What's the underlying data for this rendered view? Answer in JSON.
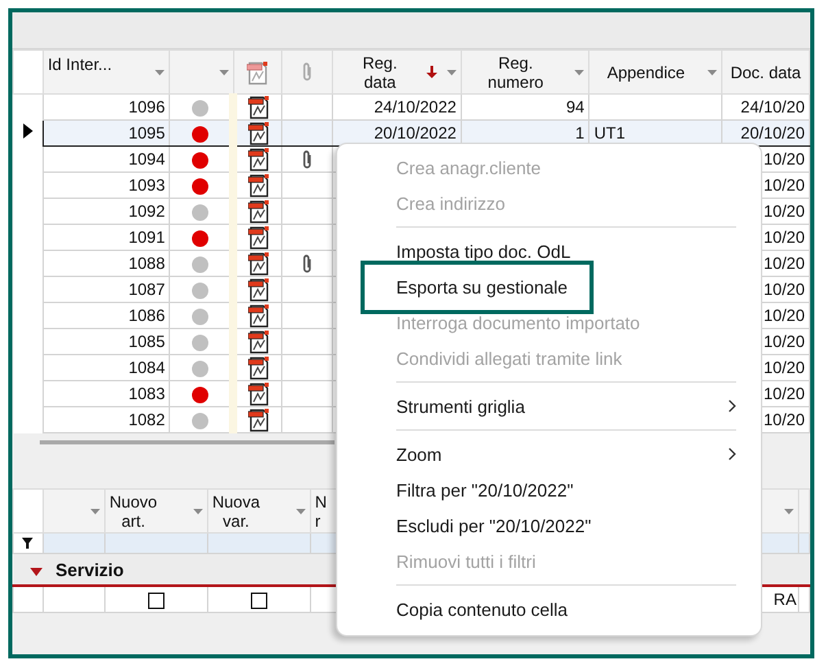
{
  "grid": {
    "columns": [
      {
        "kind": "number",
        "label": "Id Inter...",
        "filter": true
      },
      {
        "kind": "status",
        "filter": true
      },
      {
        "kind": "pdf"
      },
      {
        "kind": "attach"
      },
      {
        "kind": "date",
        "label": "Reg.\ndata",
        "sorted_desc": true,
        "filter": true
      },
      {
        "kind": "number",
        "label": "Reg.\nnumero",
        "filter": true
      },
      {
        "kind": "text",
        "label": "Appendice",
        "filter": true
      },
      {
        "kind": "date",
        "label": "Doc. data",
        "filter": false
      }
    ],
    "rows": [
      {
        "selected": false,
        "cells": [
          "1096",
          {
            "color": "#c0c0c0"
          },
          {
            "pdf": true
          },
          {
            "attachment": false
          },
          "24/10/2022",
          "94",
          "",
          "24/10/20"
        ]
      },
      {
        "selected": true,
        "cells": [
          "1095",
          {
            "color": "#e00000"
          },
          {
            "pdf": true
          },
          {
            "attachment": false
          },
          "20/10/2022",
          "1",
          "UT1",
          "20/10/20"
        ]
      },
      {
        "selected": false,
        "cells": [
          "1094",
          {
            "color": "#e00000"
          },
          {
            "pdf": true
          },
          {
            "attachment": true
          },
          "",
          "",
          "",
          "10/20"
        ]
      },
      {
        "selected": false,
        "cells": [
          "1093",
          {
            "color": "#e00000"
          },
          {
            "pdf": true
          },
          {
            "attachment": false
          },
          "",
          "",
          "",
          "10/20"
        ]
      },
      {
        "selected": false,
        "cells": [
          "1092",
          {
            "color": "#c0c0c0"
          },
          {
            "pdf": true
          },
          {
            "attachment": false
          },
          "",
          "",
          "",
          "10/20"
        ]
      },
      {
        "selected": false,
        "cells": [
          "1091",
          {
            "color": "#e00000"
          },
          {
            "pdf": true
          },
          {
            "attachment": false
          },
          "",
          "",
          "",
          "10/20"
        ]
      },
      {
        "selected": false,
        "cells": [
          "1088",
          {
            "color": "#c0c0c0"
          },
          {
            "pdf": true
          },
          {
            "attachment": true
          },
          "",
          "",
          "",
          "10/20"
        ]
      },
      {
        "selected": false,
        "cells": [
          "1087",
          {
            "color": "#c0c0c0"
          },
          {
            "pdf": true
          },
          {
            "attachment": false
          },
          "",
          "",
          "",
          "10/20"
        ]
      },
      {
        "selected": false,
        "cells": [
          "1086",
          {
            "color": "#c0c0c0"
          },
          {
            "pdf": true
          },
          {
            "attachment": false
          },
          "",
          "",
          "",
          "10/20"
        ]
      },
      {
        "selected": false,
        "cells": [
          "1085",
          {
            "color": "#c0c0c0"
          },
          {
            "pdf": true
          },
          {
            "attachment": false
          },
          "",
          "",
          "",
          "10/20"
        ]
      },
      {
        "selected": false,
        "cells": [
          "1084",
          {
            "color": "#c0c0c0"
          },
          {
            "pdf": true
          },
          {
            "attachment": false
          },
          "",
          "",
          "",
          "10/20"
        ]
      },
      {
        "selected": false,
        "cells": [
          "1083",
          {
            "color": "#e00000"
          },
          {
            "pdf": true
          },
          {
            "attachment": false
          },
          "",
          "",
          "",
          "10/20"
        ]
      },
      {
        "selected": false,
        "cells": [
          "1082",
          {
            "color": "#c0c0c0"
          },
          {
            "pdf": true
          },
          {
            "attachment": false
          },
          "",
          "",
          "",
          "10/20"
        ]
      }
    ]
  },
  "detail_grid": {
    "columns": [
      {
        "kind": "blank",
        "filter": true
      },
      {
        "kind": "check",
        "label": "Nuovo\nart.",
        "filter": true
      },
      {
        "kind": "check",
        "label": "Nuova\nvar.",
        "filter": true
      },
      {
        "kind": "text",
        "label": "N\nr",
        "filter": false
      },
      {
        "kind": "text",
        "filter": true
      },
      {
        "kind": "blank",
        "filter": false
      }
    ],
    "group": {
      "label": "Servizio",
      "expanded": true
    },
    "rows": [
      {
        "cells": [
          null,
          {
            "checked": false
          },
          {
            "checked": false
          },
          null,
          "RA",
          null
        ]
      }
    ]
  },
  "context_menu": [
    {
      "kind": "item",
      "label": "Crea anagr.cliente",
      "disabled": true,
      "submenu": false,
      "highlighted": false
    },
    {
      "kind": "item",
      "label": "Crea indirizzo",
      "disabled": true,
      "submenu": false,
      "highlighted": false
    },
    {
      "kind": "separator"
    },
    {
      "kind": "item",
      "label": "Imposta tipo doc. OdL",
      "disabled": false,
      "submenu": false,
      "highlighted": false
    },
    {
      "kind": "item",
      "label": "Esporta su gestionale",
      "disabled": false,
      "submenu": false,
      "highlighted": true
    },
    {
      "kind": "item",
      "label": "Interroga documento importato",
      "disabled": true,
      "submenu": false,
      "highlighted": false
    },
    {
      "kind": "item",
      "label": "Condividi allegati tramite link",
      "disabled": true,
      "submenu": false,
      "highlighted": false
    },
    {
      "kind": "separator"
    },
    {
      "kind": "item",
      "label": "Strumenti griglia",
      "disabled": false,
      "submenu": true,
      "highlighted": false
    },
    {
      "kind": "separator"
    },
    {
      "kind": "item",
      "label": "Zoom",
      "disabled": false,
      "submenu": true,
      "highlighted": false
    },
    {
      "kind": "item",
      "label": "Filtra per \"20/10/2022\"",
      "disabled": false,
      "submenu": false,
      "highlighted": false
    },
    {
      "kind": "item",
      "label": "Escludi per \"20/10/2022\"",
      "disabled": false,
      "submenu": false,
      "highlighted": false
    },
    {
      "kind": "item",
      "label": "Rimuovi tutti i filtri",
      "disabled": true,
      "submenu": false,
      "highlighted": false
    },
    {
      "kind": "separator"
    },
    {
      "kind": "item",
      "label": "Copia contenuto cella",
      "disabled": false,
      "submenu": false,
      "highlighted": false
    }
  ]
}
